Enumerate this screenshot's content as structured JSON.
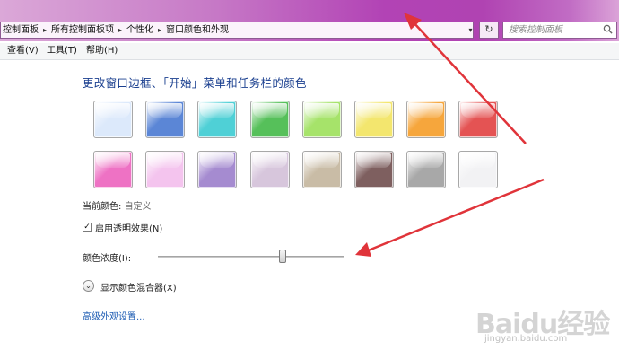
{
  "address_bar": {
    "crumbs": [
      "控制面板",
      "所有控制面板项",
      "个性化",
      "窗口颜色和外观"
    ],
    "separator": "▸",
    "dropdown": "▾",
    "refresh": "↻"
  },
  "search": {
    "placeholder": "搜索控制面板"
  },
  "menu": {
    "view": "查看(V)",
    "tools": "工具(T)",
    "help": "帮助(H)"
  },
  "main": {
    "title": "更改窗口边框、「开始」菜单和任务栏的颜色",
    "swatch_colors_row1": [
      "#dce9fb",
      "#5b86d6",
      "#4fd0d6",
      "#56c05a",
      "#a6e36a",
      "#f3e66e",
      "#f6a63c",
      "#e45353"
    ],
    "swatch_colors_row2": [
      "#ee72c4",
      "#f4c4ee",
      "#a58bd0",
      "#d7c6dc",
      "#c9bca6",
      "#7e5f5f",
      "#a8a8a8",
      "#f2f2f4"
    ],
    "current_color_label": "当前颜色:",
    "current_color_value": "自定义",
    "transparency": {
      "label": "启用透明效果(N)",
      "checked": true,
      "check_mark": "✓"
    },
    "intensity_label": "颜色浓度(I):",
    "intensity_value": 0.67,
    "mixer_label": "显示颜色混合器(X)",
    "mixer_icon": "chevron-down-icon",
    "advanced_link": "高级外观设置..."
  },
  "watermark": {
    "brand": "Baidu经验",
    "url": "jingyan.baidu.com"
  },
  "colors": {
    "annotation_arrow": "#e0343a",
    "title_text": "#1a3f8f",
    "link": "#1e5cb3"
  }
}
